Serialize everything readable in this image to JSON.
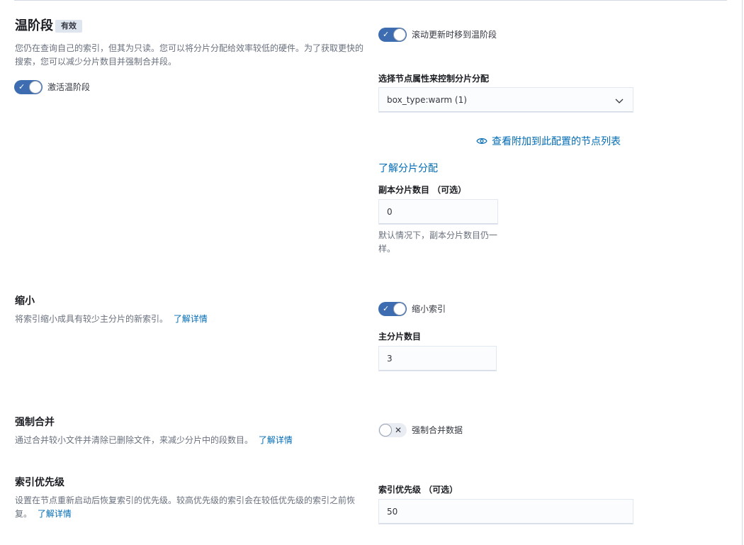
{
  "warm_phase": {
    "title": "温阶段",
    "badge": "有效",
    "description": "您仍在查询自己的索引，但其为只读。您可以将分片分配给效率较低的硬件。为了获取更快的搜索，您可以减少分片数目并强制合并段。",
    "activate_switch": {
      "label": "激活温阶段",
      "checked": true
    },
    "rollover_switch": {
      "label": "滚动更新时移到温阶段",
      "checked": true
    },
    "allocation": {
      "label": "选择节点属性来控制分片分配",
      "selected": "box_type:warm (1)",
      "view_nodes_link": "查看附加到此配置的节点列表",
      "learn_link": "了解分片分配"
    },
    "replicas": {
      "label": "副本分片数目 （可选）",
      "value": "0",
      "help": "默认情况下，副本分片数目仍一样。"
    }
  },
  "shrink": {
    "title": "缩小",
    "description": "将索引缩小成具有较少主分片的新索引。",
    "learn_link": "了解详情",
    "switch": {
      "label": "缩小索引",
      "checked": true
    },
    "primary_shards": {
      "label": "主分片数目",
      "value": "3"
    }
  },
  "forcemerge": {
    "title": "强制合并",
    "description": "通过合并较小文件并清除已删除文件，来减少分片中的段数目。",
    "learn_link": "了解详情",
    "switch": {
      "label": "强制合并数据",
      "checked": false
    }
  },
  "index_priority": {
    "title": "索引优先级",
    "description": "设置在节点重新启动后恢复索引的优先级。较高优先级的索引会在较低优先级的索引之前恢复。",
    "learn_link": "了解详情",
    "field": {
      "label": "索引优先级 （可选）",
      "value": "50"
    }
  },
  "icons": {
    "check": "check-icon",
    "cross": "cross-icon",
    "chevron": "chevron-down-icon",
    "eye": "eye-icon"
  },
  "colors": {
    "primary": "#3d6cb0",
    "link": "#006bb4",
    "text": "#343741",
    "subdued": "#69707d"
  }
}
